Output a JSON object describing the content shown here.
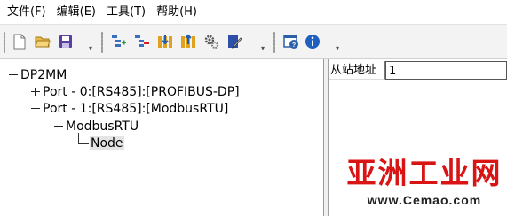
{
  "menubar": {
    "items": [
      {
        "label": "文件(F)"
      },
      {
        "label": "编辑(E)"
      },
      {
        "label": "工具(T)"
      },
      {
        "label": "帮助(H)"
      }
    ]
  },
  "toolbar": {
    "groups": [
      {
        "buttons": [
          "new-file-icon",
          "open-folder-icon",
          "save-icon"
        ]
      },
      {
        "buttons": [
          "add-node-icon",
          "delete-node-icon",
          "import-icon",
          "export-icon",
          "settings-gears-icon",
          "edit-document-icon"
        ]
      },
      {
        "buttons": [
          "help-window-icon",
          "info-icon"
        ]
      }
    ],
    "overflow_glyph": "▾"
  },
  "tree": {
    "root": {
      "label": "DP2MM"
    },
    "port0": {
      "label": "Port - 0:[RS485]:[PROFIBUS-DP]"
    },
    "port1": {
      "label": "Port - 1:[RS485]:[ModbusRTU]"
    },
    "modbus": {
      "label": "ModbusRTU"
    },
    "node": {
      "label": "Node"
    }
  },
  "properties": {
    "slave_address": {
      "label": "从站地址",
      "value": "1"
    }
  },
  "watermark": {
    "title": "亚洲工业网",
    "url": "www.Cemao.com"
  },
  "colors": {
    "watermark_red": "#d81414",
    "toolbar_bg": "#f3f3f3",
    "selection_bg": "#e4e4e4"
  }
}
